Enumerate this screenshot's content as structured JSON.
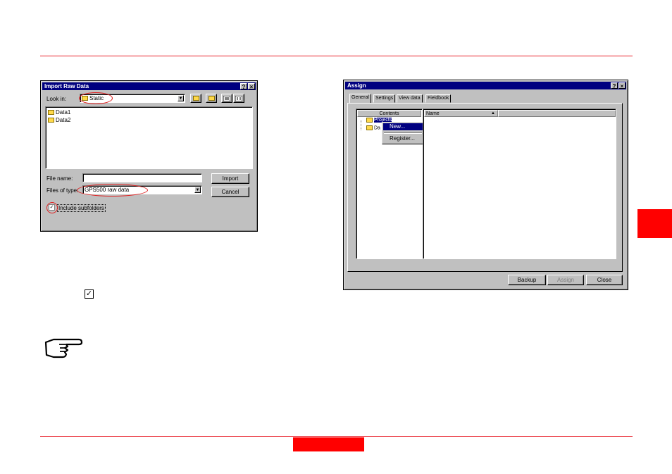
{
  "import_dialog": {
    "title": "Import Raw Data",
    "help_btn": "?",
    "close_btn": "×",
    "look_in_label": "Look in:",
    "look_in_value": "Static",
    "files": [
      "Data1",
      "Data2"
    ],
    "file_name_label": "File name:",
    "file_name_value": "",
    "files_of_type_label": "Files of type:",
    "files_of_type_value": "GPS500 raw data",
    "import_btn": "Import",
    "cancel_btn": "Cancel",
    "include_subfolders_label": "Include subfolders",
    "include_subfolders_checked": true
  },
  "assign_dialog": {
    "title": "Assign",
    "help_btn": "?",
    "close_btn": "×",
    "tabs": [
      "General",
      "Settings",
      "View data",
      "Fieldbook"
    ],
    "contents_header": "Contents",
    "name_header": "Name",
    "tree_items": [
      "Projects",
      "Da"
    ],
    "context_menu": [
      "New...",
      "Register..."
    ],
    "backup_btn": "Backup",
    "assign_btn": "Assign",
    "close_action_btn": "Close"
  },
  "page": {
    "checkbox_symbol": "☑",
    "accent_color": "#ff0000",
    "note_icon": "pointing-hand-icon"
  }
}
